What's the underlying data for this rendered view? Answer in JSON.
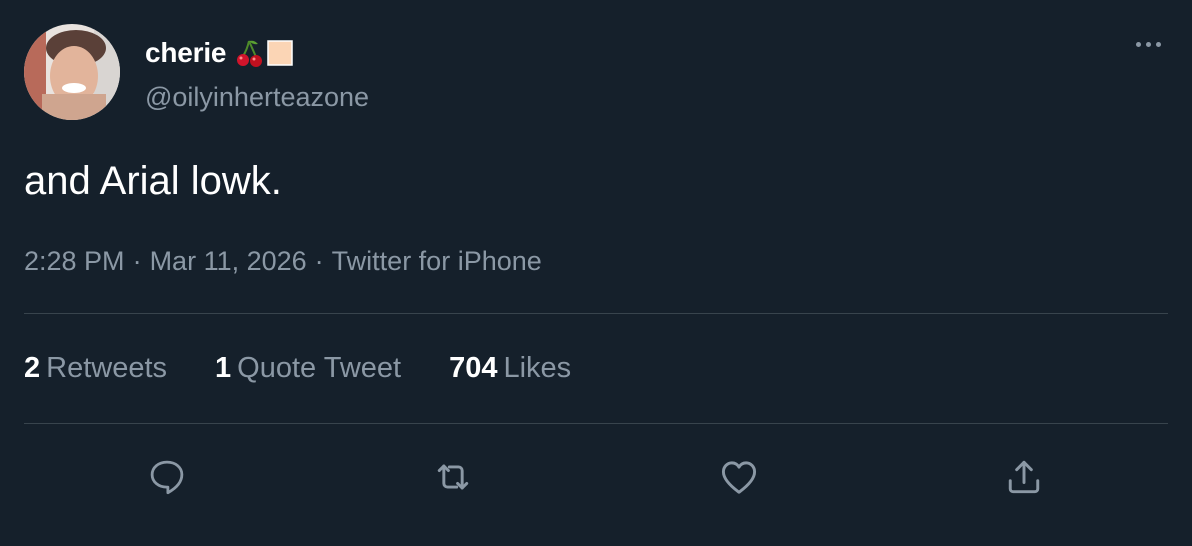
{
  "tweet": {
    "display_name": "cherie",
    "name_emojis": [
      "cherry-emoji",
      "peach-square-emoji"
    ],
    "handle": "@oilyinherteazone",
    "text": "and Arial lowk.",
    "time": "2:28 PM",
    "date": "Mar 11, 2026",
    "source": "Twitter for iPhone",
    "separator": "·"
  },
  "stats": {
    "retweets_count": "2",
    "retweets_label": "Retweets",
    "quotes_count": "1",
    "quotes_label": "Quote Tweet",
    "likes_count": "704",
    "likes_label": "Likes"
  },
  "actions": [
    "reply-icon",
    "retweet-icon",
    "like-icon",
    "share-icon"
  ],
  "colors": {
    "background": "#15202b",
    "primary_text": "#ffffff",
    "secondary_text": "#8b98a5",
    "divider": "#38444d"
  }
}
